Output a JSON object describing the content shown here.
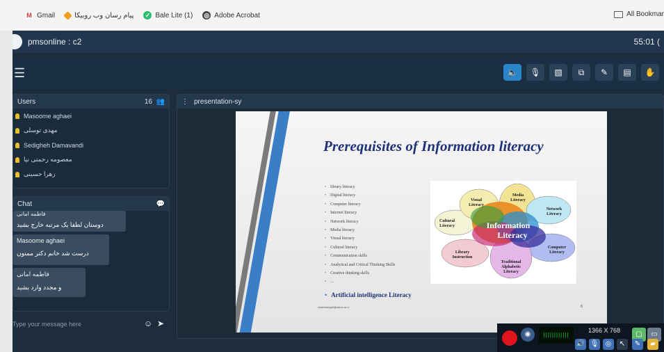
{
  "bookmarks": {
    "items": [
      {
        "label": "Gmail",
        "icon": "gmail-icon"
      },
      {
        "label": "پیام رسان وب روبیکا",
        "icon": "rubika-icon"
      },
      {
        "label": "Bale Lite (1)",
        "icon": "bale-icon"
      },
      {
        "label": "Adobe Acrobat",
        "icon": "acrobat-icon"
      }
    ],
    "all_label": "All Bookmar"
  },
  "app": {
    "title": "pmsonline : c2",
    "timer": "55:01 ("
  },
  "toolbar": {
    "buttons": [
      {
        "icon": "speaker-icon",
        "active": true
      },
      {
        "icon": "mic-off-icon",
        "active": false
      },
      {
        "icon": "camera-off-icon",
        "active": false
      },
      {
        "icon": "screen-share-icon",
        "active": false
      },
      {
        "icon": "pen-icon",
        "active": false
      },
      {
        "icon": "file-icon",
        "active": false
      },
      {
        "icon": "raise-hand-icon",
        "active": false
      }
    ]
  },
  "users": {
    "header": "Users",
    "count": "16",
    "list": [
      "Masoome aghaei",
      "مهدی توسلی",
      "Sedigheh Damavandi",
      "معصومه رحمتی نیا",
      "زهرا حسینی"
    ]
  },
  "chat": {
    "header": "Chat",
    "messages": [
      {
        "sender": "فاطمه امانی",
        "text": "دوستان لطفا یک مرتبه خارج بشید"
      },
      {
        "sender": "Masoome aghaei",
        "text": "درست شد خانم دکتر ممنون"
      },
      {
        "sender": "فاطمه امانی",
        "text": "و مجدد وارد بشید"
      }
    ],
    "input_placeholder": "Type your message here"
  },
  "presentation": {
    "header": "presentation-sy",
    "slide": {
      "title": "Prerequisites of Information literacy",
      "bullets": [
        "library literacy",
        "Digital literacy",
        "Computer literacy",
        "Internet literacy",
        "Network literacy",
        "Media literacy",
        "Visual literacy",
        "Cultural literacy",
        "Communication skills",
        "Analytical and Critical Thinking Skills",
        "Creative thinking skills",
        "..."
      ],
      "highlight_bullet": "Artificial intelligence Literacy",
      "email": "shahbadaghi@sbmu.ac.ir",
      "page_number": "8",
      "flower_center": [
        "Information",
        "Literacy"
      ],
      "petals": [
        [
          "Media",
          "Literacy"
        ],
        [
          "Network",
          "Literacy"
        ],
        [
          "Computer",
          "Literacy"
        ],
        [
          "Traditional",
          "Alphabetic",
          "Literacy"
        ],
        [
          "Library",
          "Instruction"
        ],
        [
          "Cultural",
          "Literacy"
        ],
        [
          "Visual",
          "Literacy"
        ]
      ]
    }
  },
  "recorder": {
    "resolution": "1366 X 768",
    "meter_text": "||||||||||||"
  }
}
